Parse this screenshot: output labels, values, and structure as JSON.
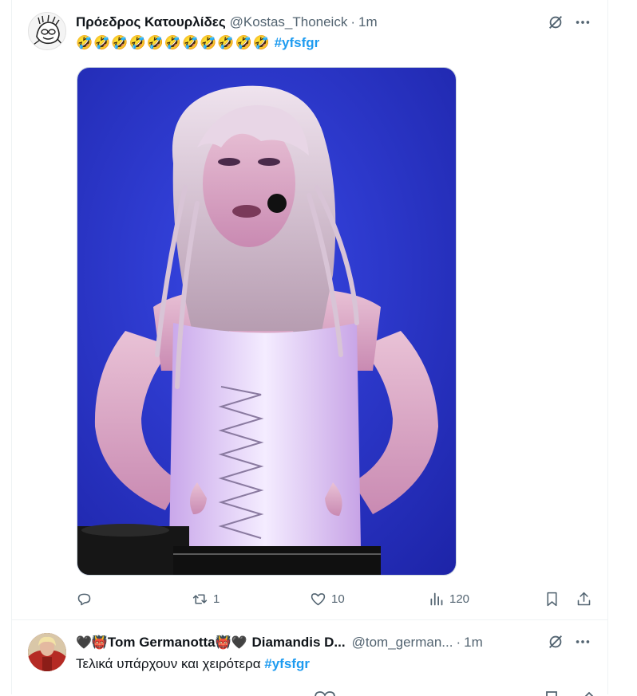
{
  "tweets": [
    {
      "display_name": "Πρόεδρος Κατουρλίδες",
      "handle": "@Kostas_Thoneick",
      "separator": "·",
      "time": "1m",
      "text_emojis": "🤣🤣🤣🤣🤣🤣🤣🤣🤣🤣🤣",
      "hashtag": "#yfsfgr",
      "media": "photo-performer-white-corset",
      "stats": {
        "replies": "",
        "reposts": "1",
        "likes": "10",
        "views": "120"
      }
    },
    {
      "name_prefix_heart": "🖤",
      "name_prefix_ogre": "👹",
      "display_name_1": "Tom Germanotta",
      "name_mid_ogre": "👹",
      "name_mid_heart": "🖤",
      "display_name_2": "Diamandis D...",
      "handle": "@tom_german...",
      "separator": "·",
      "time": "1m",
      "text": "Τελικά υπάρχουν και χειρότερα",
      "hashtag": "#yfsfgr"
    }
  ],
  "colors": {
    "accent": "#1d9bf0",
    "secondary_text": "#536471",
    "border": "#eff3f4",
    "media_background": "#2a36c8"
  },
  "icons": {
    "reply": "reply-icon",
    "repost": "repost-icon",
    "like": "heart-icon",
    "views": "views-chart-icon",
    "bookmark": "bookmark-icon",
    "share": "share-icon",
    "grok": "grok-icon",
    "more": "more-icon"
  }
}
